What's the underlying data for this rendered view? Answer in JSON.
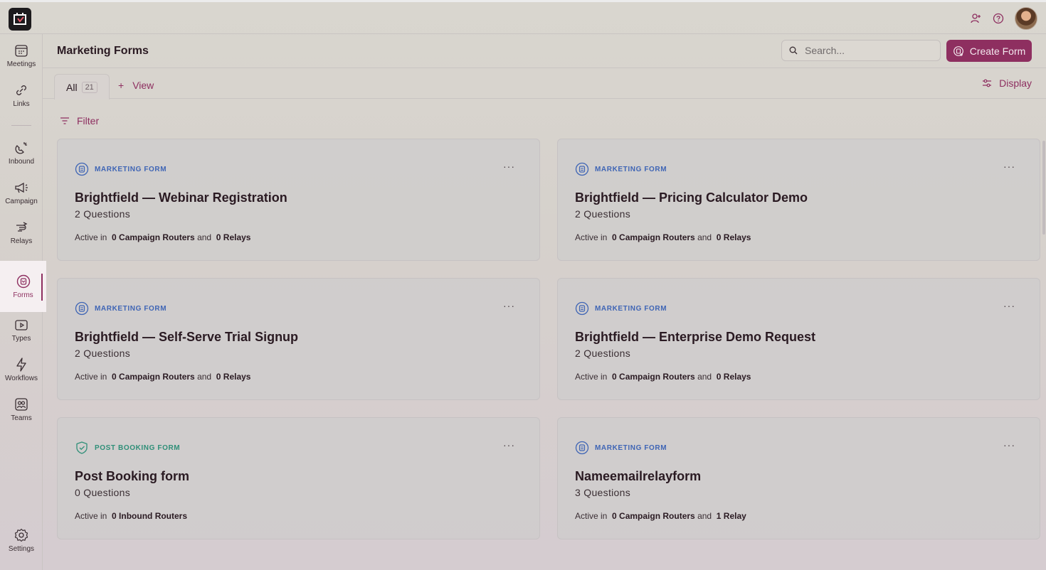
{
  "header": {
    "title": "Marketing Forms"
  },
  "search": {
    "placeholder": "Search..."
  },
  "create_form": {
    "label": "Create Form"
  },
  "tabs": {
    "all_label": "All",
    "all_count": "21",
    "view_label": "View"
  },
  "display": {
    "label": "Display"
  },
  "filter": {
    "label": "Filter"
  },
  "sidebar": {
    "items": [
      {
        "label": "Meetings"
      },
      {
        "label": "Links"
      },
      {
        "label": "Inbound"
      },
      {
        "label": "Campaign"
      },
      {
        "label": "Relays"
      },
      {
        "label": "Forms"
      },
      {
        "label": "Types"
      },
      {
        "label": "Workflows"
      },
      {
        "label": "Teams"
      },
      {
        "label": "Settings"
      }
    ]
  },
  "cards": [
    {
      "type": "MARKETING FORM",
      "title": "Brightfield — Webinar Registration",
      "questions": "2 Questions",
      "active_prefix": "Active in",
      "routers": "0 Campaign Routers",
      "joiner": "and",
      "relays": "0 Relays"
    },
    {
      "type": "MARKETING FORM",
      "title": "Brightfield — Pricing Calculator Demo",
      "questions": "2 Questions",
      "active_prefix": "Active in",
      "routers": "0 Campaign Routers",
      "joiner": "and",
      "relays": "0 Relays"
    },
    {
      "type": "MARKETING FORM",
      "title": "Brightfield — Self-Serve Trial Signup",
      "questions": "2 Questions",
      "active_prefix": "Active in",
      "routers": "0 Campaign Routers",
      "joiner": "and",
      "relays": "0 Relays"
    },
    {
      "type": "MARKETING FORM",
      "title": "Brightfield — Enterprise Demo Request",
      "questions": "2 Questions",
      "active_prefix": "Active in",
      "routers": "0 Campaign Routers",
      "joiner": "and",
      "relays": "0 Relays"
    },
    {
      "type": "POST BOOKING FORM",
      "title": "Post Booking form",
      "questions": "0 Questions",
      "active_prefix": "Active in",
      "routers": "0 Inbound Routers"
    },
    {
      "type": "MARKETING FORM",
      "title": "Nameemailrelayform",
      "questions": "3 Questions",
      "active_prefix": "Active in",
      "routers": "0 Campaign Routers",
      "joiner": "and",
      "relays": "1 Relay"
    }
  ],
  "more_label": "···",
  "colors": {
    "accent": "#8e2f60",
    "marketing": "#3f65b5",
    "post_booking": "#2f8f78"
  }
}
